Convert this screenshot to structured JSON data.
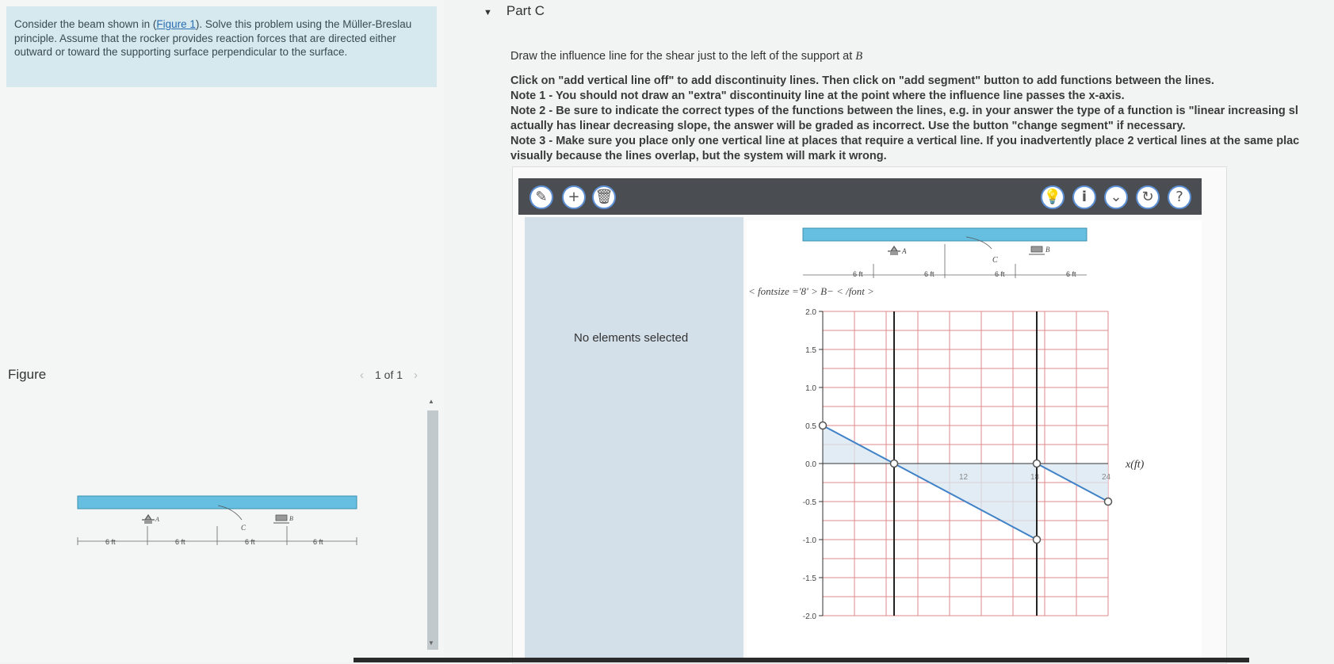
{
  "problem": {
    "text_before_link": "Consider the beam shown in (",
    "link_text": "Figure 1",
    "text_after_link": "). Solve this problem using the Müller-Breslau principle. Assume that the rocker provides reaction forces that are directed either outward or toward the supporting surface perpendicular to the surface."
  },
  "figure": {
    "label": "Figure",
    "pager_prev": "‹",
    "pager_text": "1 of 1",
    "pager_next": "›"
  },
  "beam": {
    "support_a": "A",
    "support_b": "B",
    "point_c": "C",
    "span_labels": [
      "6 ft",
      "6 ft",
      "6 ft",
      "6 ft"
    ]
  },
  "part": {
    "title": "Part C",
    "prompt_prefix": "Draw the influence line for the shear just to the left of the support at ",
    "prompt_var": "B",
    "instructions": [
      "Click on \"add vertical line off\" to add discontinuity lines. Then click on \"add segment\" button to add functions between the lines.",
      "Note 1 - You should not draw an \"extra\" discontinuity line at the point where the influence line passes the x-axis.",
      "Note 2 - Be sure to indicate the correct types of the functions between the lines, e.g. in your answer the type of a function is \"linear increasing sl",
      "actually has linear decreasing slope, the answer will be graded as incorrect. Use the button \"change segment\" if necessary.",
      "Note 3 - Make sure you place only one vertical line at places that require a vertical line. If you inadvertently place 2 vertical lines at the same plac",
      "visually because the lines overlap, but the system will mark it wrong."
    ]
  },
  "toolbar": {
    "left_buttons": [
      {
        "name": "add-vertical-line-icon",
        "glyph": "✎"
      },
      {
        "name": "add-segment-icon",
        "glyph": "+"
      },
      {
        "name": "delete-icon",
        "glyph": "🗑"
      }
    ],
    "right_buttons": [
      {
        "name": "hint-icon",
        "glyph": "💡"
      },
      {
        "name": "info-icon",
        "glyph": "i"
      },
      {
        "name": "dropdown-icon",
        "glyph": "⌄"
      },
      {
        "name": "reset-icon",
        "glyph": "↻"
      },
      {
        "name": "help-icon",
        "glyph": "?"
      }
    ]
  },
  "side_panel": {
    "status": "No elements selected"
  },
  "graph": {
    "broken_label": "< fontsize ='8' > B− < /font >",
    "x_axis_label": "x(ft)",
    "colors": {
      "grid": "#e08a8a",
      "line": "#3f82c8",
      "fill": "#d8e6f0",
      "vertical": "#222222"
    }
  },
  "chart_data": {
    "type": "line",
    "ylim": [
      -2.0,
      2.0
    ],
    "y_ticks": [
      "2.0",
      "1.5",
      "1.0",
      "0.5",
      "0.0",
      "-0.5",
      "-1.0",
      "-1.5",
      "-2.0"
    ],
    "xlim": [
      0,
      24
    ],
    "x_ticks": [
      "12",
      "18",
      "24"
    ],
    "vertical_lines_x": [
      6,
      18
    ],
    "points": [
      {
        "x": 0,
        "y": 0.5
      },
      {
        "x": 6,
        "y": 0.0
      },
      {
        "x": 18,
        "y": -1.0
      },
      {
        "x": 18,
        "y": 0.0
      },
      {
        "x": 24,
        "y": -0.5
      }
    ],
    "segments": [
      [
        {
          "x": 0,
          "y": 0.5
        },
        {
          "x": 6,
          "y": 0.0
        }
      ],
      [
        {
          "x": 6,
          "y": 0.0
        },
        {
          "x": 18,
          "y": -1.0
        }
      ],
      [
        {
          "x": 18,
          "y": 0.0
        },
        {
          "x": 24,
          "y": -0.5
        }
      ]
    ]
  }
}
